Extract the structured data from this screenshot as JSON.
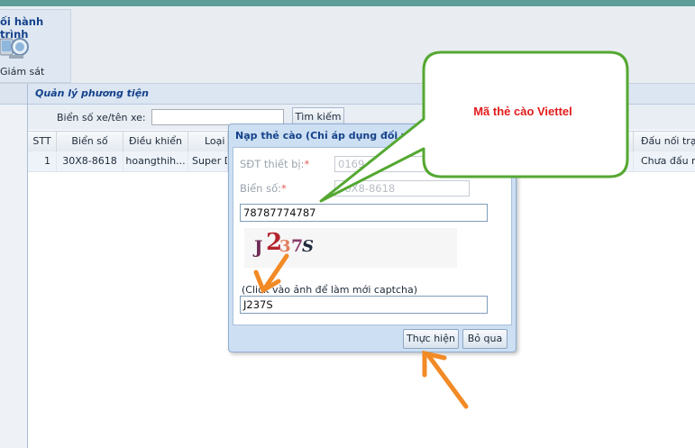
{
  "ribbon": {
    "group_title": "ối hành trình",
    "monitor_label": "Giám sát",
    "monitor_icon": "monitor-icon"
  },
  "panel": {
    "title": "Quản lý phương tiện",
    "search_label": "Biển số xe/tên xe:",
    "search_value": "",
    "search_button": "Tìm kiếm"
  },
  "grid": {
    "columns": [
      "STT",
      "Biển số",
      "Điều khiển",
      "Loại x",
      "",
      "Đấu nối trạ"
    ],
    "row": [
      "1",
      "30X8-8618",
      "hoangthih...",
      "Super D",
      "",
      "Chưa đấu nố"
    ]
  },
  "dialog": {
    "title": "Nạp thẻ cào (Chỉ áp dụng đối với t",
    "phone_label": "SĐT thiết bị:",
    "phone_value": "0169 139",
    "plate_label": "Biển số:",
    "plate_value": "30X8-8618",
    "required_mark": "*",
    "card_value": "78787774787",
    "captcha_chars": [
      "J",
      "2",
      "3",
      "7",
      "S"
    ],
    "captcha_hint": "(Click vào ảnh để làm mới captcha)",
    "captcha_value": "J237S",
    "submit_button": "Thực hiện",
    "cancel_button": "Bỏ qua"
  },
  "callout": {
    "text": "Mã thẻ cào Viettel"
  },
  "colors": {
    "topbar": "#5e9e98",
    "title_blue": "#15428b",
    "callout_border": "#55a832",
    "callout_text": "#e31b1b",
    "arrow": "#f28a25"
  }
}
